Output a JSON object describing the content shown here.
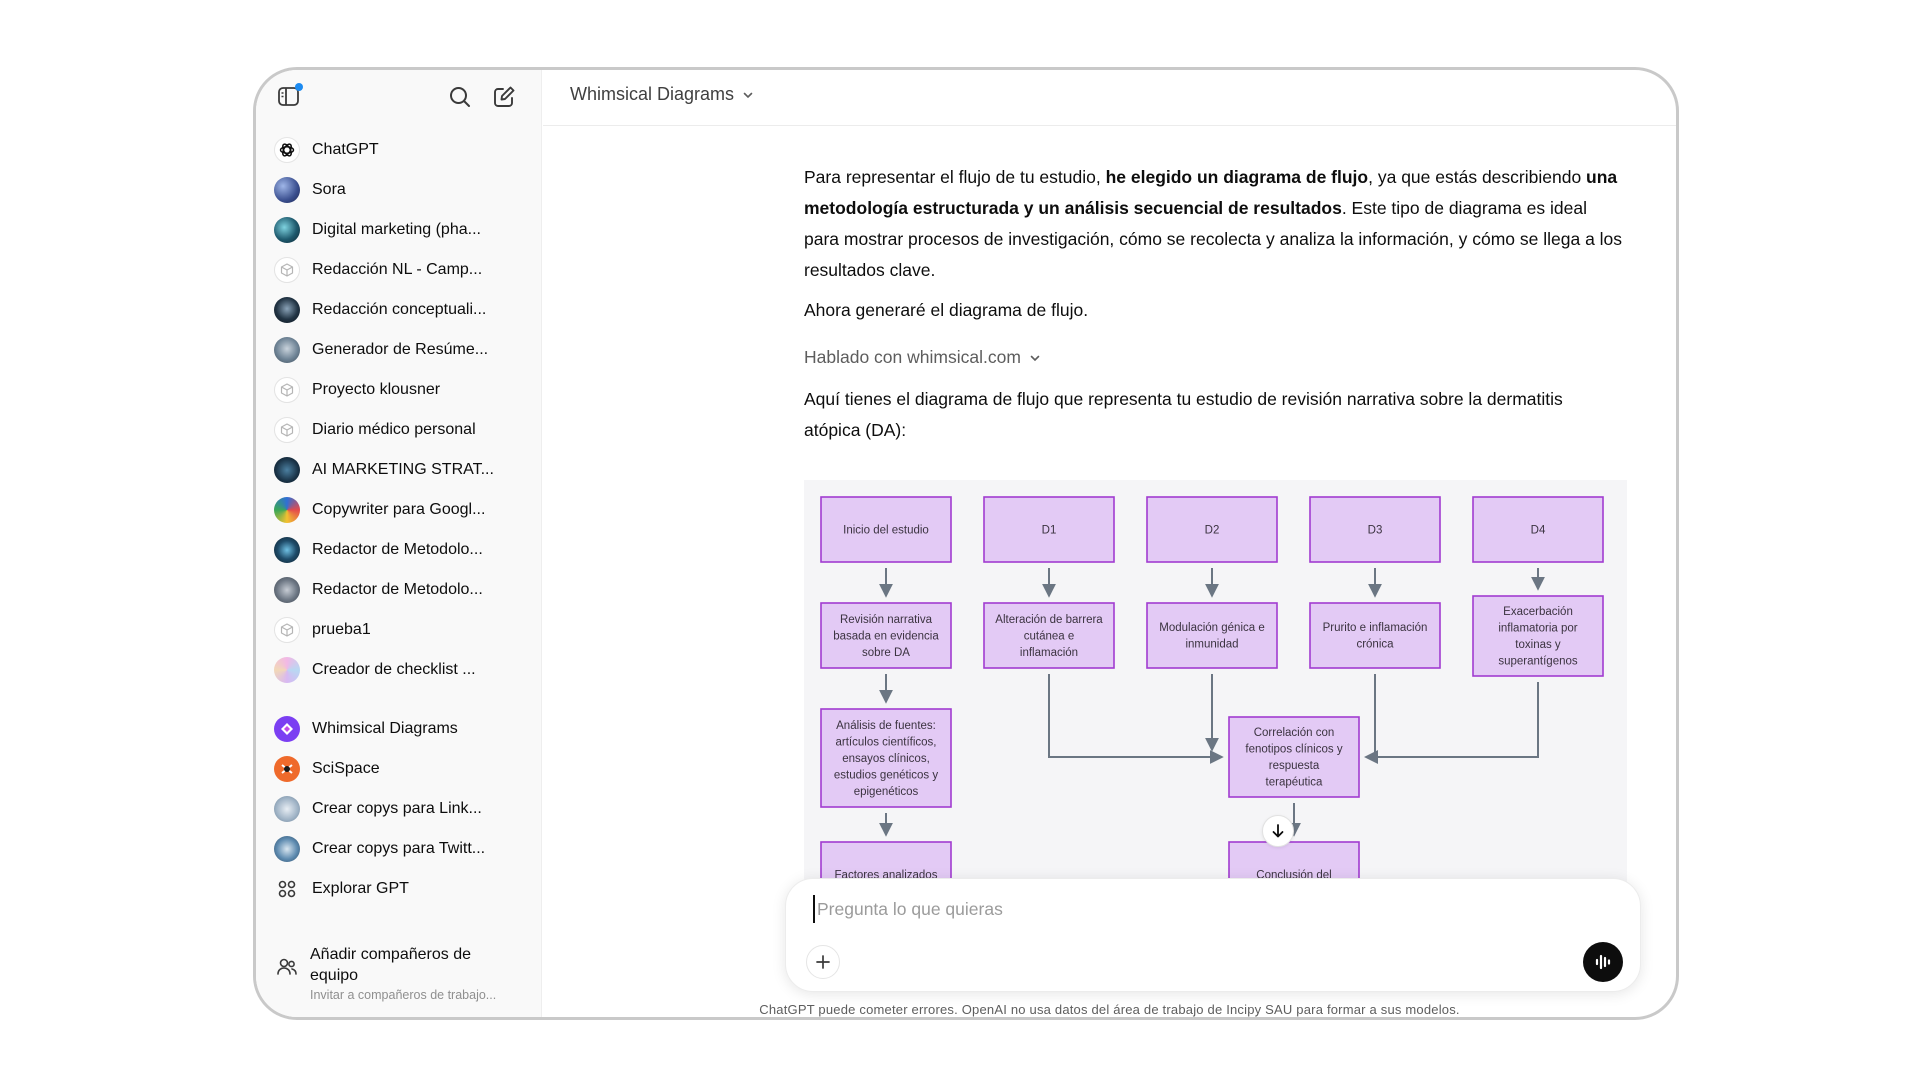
{
  "sidebar": {
    "items": [
      {
        "label": "ChatGPT",
        "icon": "openai-logo-icon"
      },
      {
        "label": "Sora",
        "icon": "sora-avatar"
      },
      {
        "label": "Digital marketing (pha...",
        "icon": "gpt-avatar"
      },
      {
        "label": "Redacción NL - Camp...",
        "icon": "cube-icon"
      },
      {
        "label": "Redacción conceptuali...",
        "icon": "gpt-avatar"
      },
      {
        "label": "Generador de Resúme...",
        "icon": "gpt-avatar"
      },
      {
        "label": "Proyecto klousner",
        "icon": "cube-icon"
      },
      {
        "label": "Diario médico personal",
        "icon": "cube-icon"
      },
      {
        "label": "AI MARKETING STRAT...",
        "icon": "gpt-avatar"
      },
      {
        "label": "Copywriter para Googl...",
        "icon": "gpt-avatar"
      },
      {
        "label": "Redactor de Metodolo...",
        "icon": "gpt-avatar"
      },
      {
        "label": "Redactor de Metodolo...",
        "icon": "gpt-avatar"
      },
      {
        "label": "prueba1",
        "icon": "cube-icon"
      },
      {
        "label": "Creador de checklist ...",
        "icon": "gpt-avatar"
      }
    ],
    "gpts": [
      {
        "label": "Whimsical Diagrams",
        "icon": "whimsical-logo-icon"
      },
      {
        "label": "SciSpace",
        "icon": "scispace-logo-icon"
      },
      {
        "label": "Crear copys para Link...",
        "icon": "gpt-avatar"
      },
      {
        "label": "Crear copys para Twitt...",
        "icon": "gpt-avatar"
      },
      {
        "label": "Explorar GPT",
        "icon": "grid-icon"
      }
    ],
    "add_team": {
      "title": "Añadir compañeros de equipo",
      "subtitle": "Invitar a compañeros de trabajo..."
    }
  },
  "header": {
    "model": "Whimsical Diagrams"
  },
  "message": {
    "p1_a": "Para representar el flujo de tu estudio, ",
    "p1_b": "he elegido un diagrama de flujo",
    "p1_c": ", ya que estás describiendo ",
    "p1_d": "una metodología estructurada y un análisis secuencial de resultados",
    "p1_e": ". Este tipo de diagrama es ideal para mostrar procesos de investigación, cómo se recolecta y analiza la información, y cómo se llega a los resultados clave.",
    "p2": "Ahora generaré el diagrama de flujo.",
    "tool_label": "Hablado con whimsical.com",
    "p3": "Aquí tienes el diagrama de flujo que representa tu estudio de revisión narrativa sobre la dermatitis atópica (DA):"
  },
  "diagram": {
    "nodes": [
      {
        "id": "inicio",
        "lines": [
          "Inicio del estudio"
        ]
      },
      {
        "id": "d1",
        "lines": [
          "D1"
        ]
      },
      {
        "id": "d2",
        "lines": [
          "D2"
        ]
      },
      {
        "id": "d3",
        "lines": [
          "D3"
        ]
      },
      {
        "id": "d4",
        "lines": [
          "D4"
        ]
      },
      {
        "id": "revision",
        "lines": [
          "Revisión narrativa",
          "basada en evidencia",
          "sobre DA"
        ]
      },
      {
        "id": "alteracion",
        "lines": [
          "Alteración de barrera",
          "cutánea e",
          "inflamación"
        ]
      },
      {
        "id": "modulacion",
        "lines": [
          "Modulación génica e",
          "inmunidad"
        ]
      },
      {
        "id": "prurito",
        "lines": [
          "Prurito e inflamación",
          "crónica"
        ]
      },
      {
        "id": "exacerbacion",
        "lines": [
          "Exacerbación",
          "inflamatoria por",
          "toxinas y",
          "superantígenos"
        ]
      },
      {
        "id": "analisis",
        "lines": [
          "Análisis de fuentes:",
          "artículos científicos,",
          "ensayos clínicos,",
          "estudios genéticos y",
          "epigenéticos"
        ]
      },
      {
        "id": "correlacion",
        "lines": [
          "Correlación con",
          "fenotipos clínicos y",
          "respuesta",
          "terapéutica"
        ]
      },
      {
        "id": "factores",
        "lines": [
          "Factores analizados"
        ]
      },
      {
        "id": "conclusion",
        "lines": [
          "Conclusión del"
        ]
      }
    ]
  },
  "composer": {
    "placeholder": "Pregunta lo que quieras"
  },
  "disclaimer": "ChatGPT puede cometer errores. OpenAI no usa datos del área de trabajo de Incipy SAU para formar a sus modelos.",
  "colors": {
    "node_fill": "#e3caf5",
    "node_stroke": "#a13bd0",
    "edge": "#6b7683",
    "accent_dot": "#1d8bf1"
  }
}
